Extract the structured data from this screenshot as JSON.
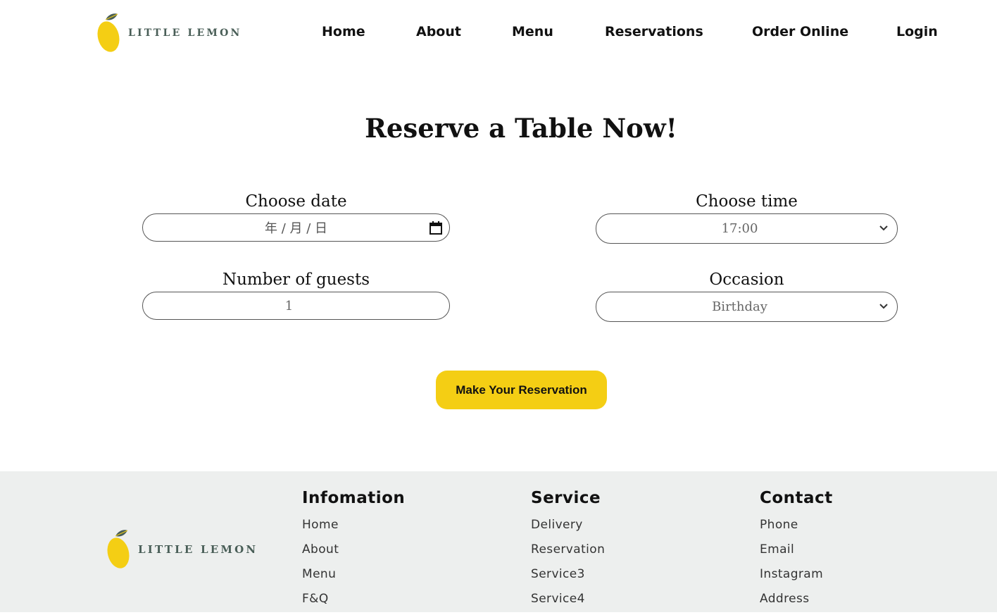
{
  "brand": {
    "name": "LITTLE LEMON",
    "leaf_color": "#495e57",
    "lemon_color": "#f4ce14"
  },
  "nav": {
    "items": [
      {
        "label": "Home"
      },
      {
        "label": "About"
      },
      {
        "label": "Menu"
      },
      {
        "label": "Reservations"
      },
      {
        "label": "Order Online"
      },
      {
        "label": "Login"
      }
    ]
  },
  "form": {
    "title": "Reserve a Table Now!",
    "date": {
      "label": "Choose date",
      "placeholder": "年 / 月 / 日"
    },
    "time": {
      "label": "Choose time",
      "value": "17:00"
    },
    "guests": {
      "label": "Number of guests",
      "value": "1"
    },
    "occasion": {
      "label": "Occasion",
      "value": "Birthday"
    },
    "submit_label": "Make Your Reservation",
    "accent": "#f4ce14"
  },
  "footer": {
    "background": "#edefee",
    "columns": [
      {
        "heading": "Infomation",
        "links": [
          "Home",
          "About",
          "Menu",
          "F&Q"
        ]
      },
      {
        "heading": "Service",
        "links": [
          "Delivery",
          "Reservation",
          "Service3",
          "Service4"
        ]
      },
      {
        "heading": "Contact",
        "links": [
          "Phone",
          "Email",
          "Instagram",
          "Address"
        ]
      }
    ]
  }
}
